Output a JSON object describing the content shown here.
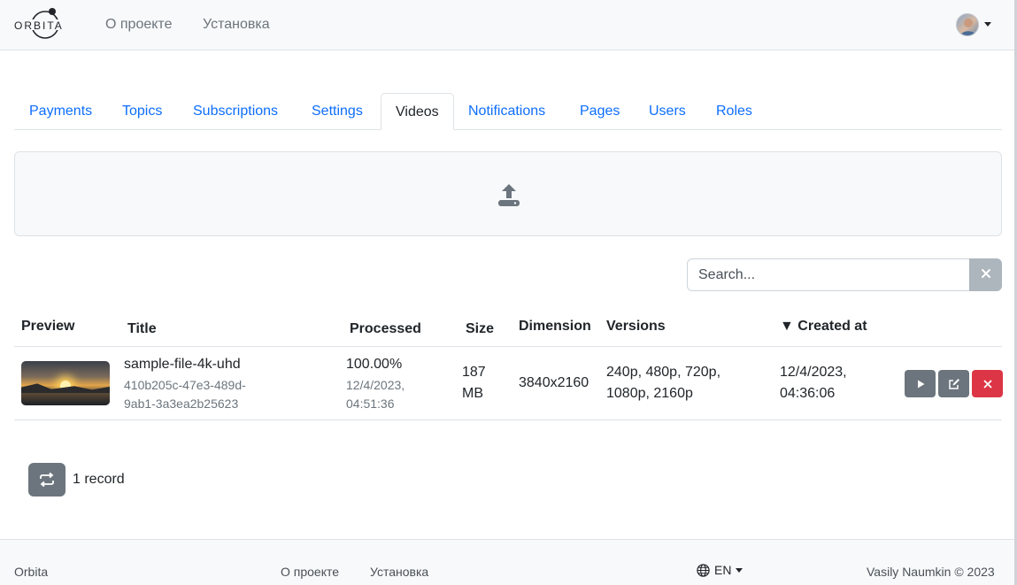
{
  "navbar": {
    "logo_text": "ORBITA",
    "links": [
      "О проекте",
      "Установка"
    ]
  },
  "tabs": [
    {
      "label": "Payments",
      "active": false
    },
    {
      "label": "Topics",
      "active": false
    },
    {
      "label": "Subscriptions",
      "active": false
    },
    {
      "label": "Settings",
      "active": false
    },
    {
      "label": "Videos",
      "active": true
    },
    {
      "label": "Notifications",
      "active": false
    },
    {
      "label": "Pages",
      "active": false
    },
    {
      "label": "Users",
      "active": false
    },
    {
      "label": "Roles",
      "active": false
    }
  ],
  "search": {
    "placeholder": "Search...",
    "value": ""
  },
  "table": {
    "headers": {
      "preview": "Preview",
      "title": "Title",
      "processed": "Processed",
      "size": "Size",
      "dimension": "Dimension",
      "versions": "Versions",
      "created_at": "▼ Created at"
    },
    "rows": [
      {
        "title": "sample-file-4k-uhd",
        "uuid_line1": "410b205c-47e3-489d-",
        "uuid_line2": "9ab1-3a3ea2b25623",
        "processed": "100.00%",
        "processed_date": "12/4/2023,",
        "processed_time": "04:51:36",
        "size_value": "187",
        "size_unit": "MB",
        "dimension": "3840x2160",
        "versions_line1": "240p, 480p, 720p,",
        "versions_line2": "1080p, 2160p",
        "created_date": "12/4/2023,",
        "created_time": "04:36:06"
      }
    ]
  },
  "records_label": "1 record",
  "footer": {
    "brand": "Orbita",
    "links": [
      "О проекте",
      "Установка"
    ],
    "language": "EN",
    "copyright": "Vasily Naumkin © 2023"
  },
  "colors": {
    "link": "#0d6efd",
    "secondary": "#6c757d",
    "danger": "#dc3545",
    "light_bg": "#f8f9fa"
  }
}
